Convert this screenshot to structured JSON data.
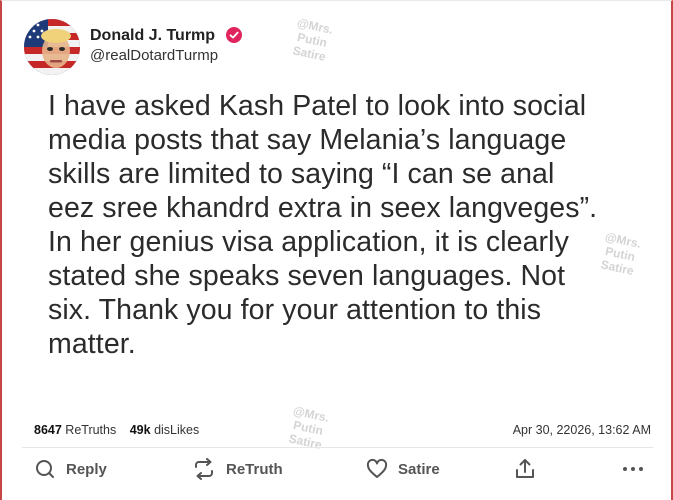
{
  "author": {
    "name": "Donald J. Turmp",
    "handle": "@realDotardTurmp",
    "verified_color": "#e0245e"
  },
  "post": {
    "lines": [
      "I have asked Kash Patel to look into social",
      "media posts that say Melania’s language",
      "skills are limited to saying “I can se anal",
      "eez sree khandrd extra in seex langveges”.",
      "In her genius visa application, it is clearly",
      "stated she speaks seven languages. Not",
      "six. Thank you for your attention to this",
      "matter."
    ]
  },
  "stats": {
    "retruths_count": "8647",
    "retruths_label": "ReTruths",
    "dislikes_count": "49k",
    "dislikes_label": "disLikes",
    "timestamp": "Apr 30, 22026, 13:62 AM"
  },
  "actions": {
    "reply": "Reply",
    "retruth": "ReTruth",
    "satire": "Satire"
  },
  "watermark": {
    "line1": "@Mrs.",
    "line2": "Putin",
    "line3": "Satire"
  },
  "icons": {
    "reply": "reply-icon",
    "retruth": "retruth-icon",
    "satire": "heart-icon",
    "share": "share-icon",
    "more": "more-icon",
    "verified": "verified-badge-icon"
  }
}
